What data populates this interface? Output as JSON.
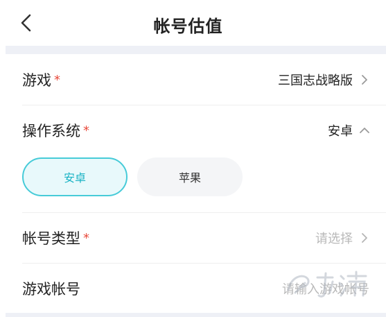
{
  "header": {
    "title": "帐号估值",
    "back_icon": "chevron-left-icon"
  },
  "form": {
    "game": {
      "label": "游戏",
      "required_mark": "*",
      "value": "三国志战略版"
    },
    "os": {
      "label": "操作系统",
      "required_mark": "*",
      "value": "安卓",
      "options": [
        "安卓",
        "苹果"
      ],
      "selected": "安卓"
    },
    "account_type": {
      "label": "帐号类型",
      "required_mark": "*",
      "placeholder": "请选择"
    },
    "game_account": {
      "label": "游戏帐号",
      "placeholder": "请输入游戏帐号"
    }
  },
  "colors": {
    "accent": "#46cbd8",
    "accent_text": "#19b3c4",
    "required": "#e84a3c"
  }
}
